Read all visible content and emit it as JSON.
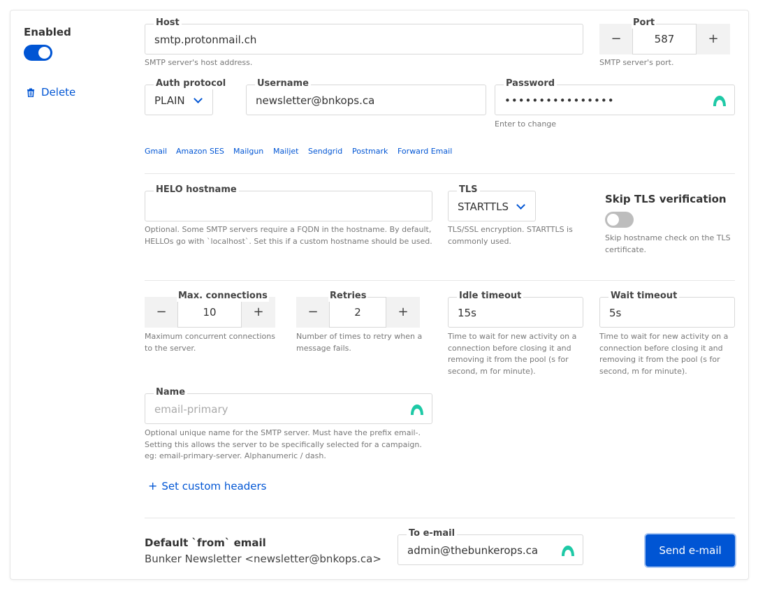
{
  "enabled": {
    "label": "Enabled",
    "on": true
  },
  "delete": {
    "label": "Delete",
    "icon": "trash-icon"
  },
  "host": {
    "label": "Host",
    "value": "smtp.protonmail.ch",
    "help": "SMTP server's host address."
  },
  "port": {
    "label": "Port",
    "value": "587",
    "help": "SMTP server's port.",
    "minus": "−",
    "plus": "+"
  },
  "auth_protocol": {
    "label": "Auth protocol",
    "value": "PLAIN"
  },
  "username": {
    "label": "Username",
    "value": "newsletter@bnkops.ca"
  },
  "password": {
    "label": "Password",
    "value": "••••••••••••••••",
    "help": "Enter to change"
  },
  "providers": [
    "Gmail",
    "Amazon SES",
    "Mailgun",
    "Mailjet",
    "Sendgrid",
    "Postmark",
    "Forward Email"
  ],
  "helo": {
    "label": "HELO hostname",
    "value": "",
    "help": "Optional. Some SMTP servers require a FQDN in the hostname. By default, HELLOs go with `localhost`. Set this if a custom hostname should be used."
  },
  "tls": {
    "label": "TLS",
    "value": "STARTTLS",
    "help": "TLS/SSL encryption. STARTTLS is commonly used."
  },
  "skip_tls": {
    "label": "Skip TLS verification",
    "on": false,
    "help": "Skip hostname check on the TLS certificate."
  },
  "max_connections": {
    "label": "Max. connections",
    "value": "10",
    "help": "Maximum concurrent connections to the server.",
    "minus": "−",
    "plus": "+"
  },
  "retries": {
    "label": "Retries",
    "value": "2",
    "help": "Number of times to retry when a message fails.",
    "minus": "−",
    "plus": "+"
  },
  "idle_timeout": {
    "label": "Idle timeout",
    "value": "15s",
    "help": "Time to wait for new activity on a connection before closing it and removing it from the pool (s for second, m for minute)."
  },
  "wait_timeout": {
    "label": "Wait timeout",
    "value": "5s",
    "help": "Time to wait for new activity on a connection before closing it and removing it from the pool (s for second, m for minute)."
  },
  "name": {
    "label": "Name",
    "placeholder": "email-primary",
    "help": "Optional unique name for the SMTP server. Must have the prefix email-. Setting this allows the server to be specifically selected for a campaign. eg: email-primary-server. Alphanumeric / dash."
  },
  "custom_headers": {
    "label": "Set custom headers",
    "icon": "plus-icon"
  },
  "from_email": {
    "title": "Default `from` email",
    "value": "Bunker Newsletter <newsletter@bnkops.ca>"
  },
  "to_email": {
    "label": "To e-mail",
    "value": "admin@thebunkerops.ca"
  },
  "send_button": {
    "label": "Send e-mail"
  },
  "colors": {
    "accent": "#0055d4",
    "eye_icon": "#1ec9a6",
    "toggle_off": "#bdbdbd"
  }
}
